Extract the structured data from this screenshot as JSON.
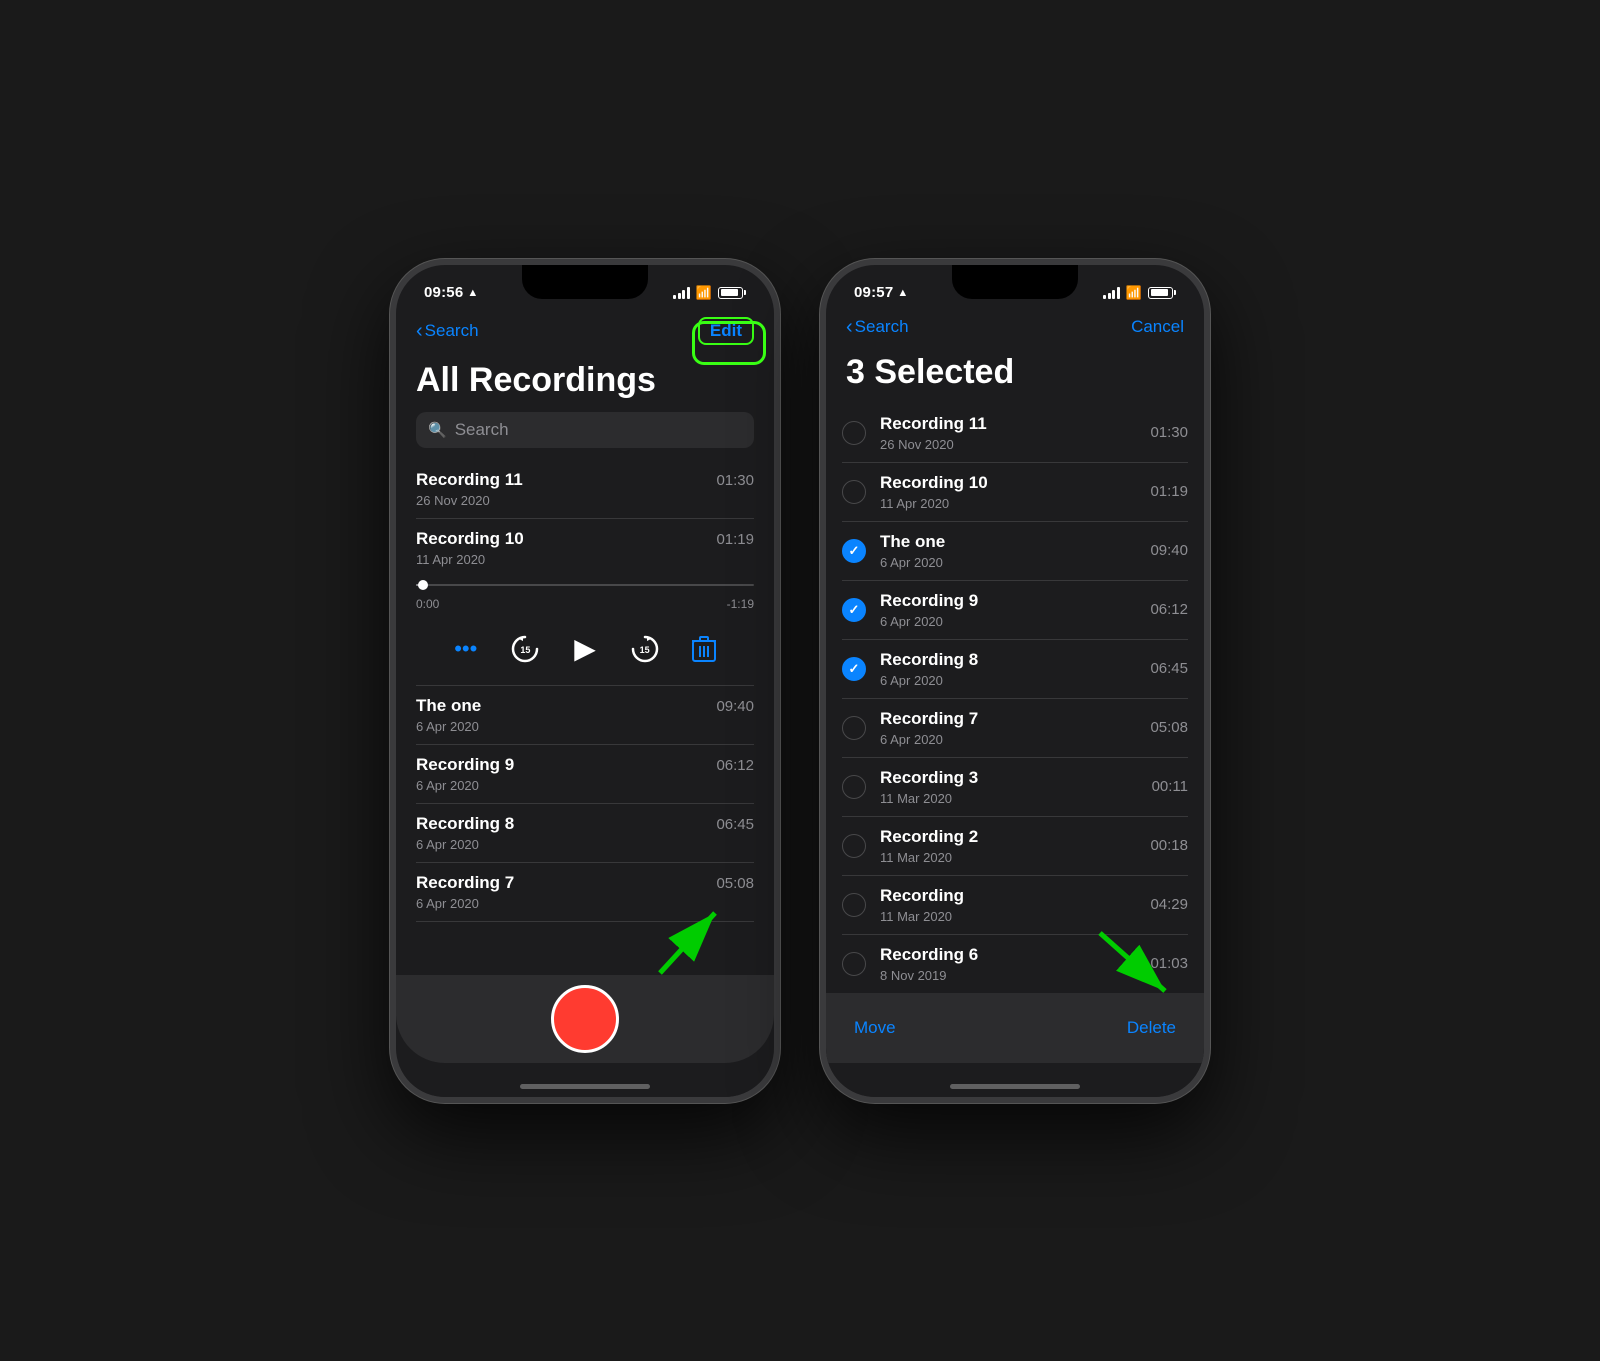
{
  "phone1": {
    "status": {
      "time": "09:56",
      "location_arrow": "▶",
      "signal": [
        4,
        4,
        4,
        4
      ],
      "wifi": true,
      "battery": 85
    },
    "nav": {
      "back_label": "Search",
      "action_label": "Edit"
    },
    "title": "All Recordings",
    "search_placeholder": "Search",
    "recordings": [
      {
        "name": "Recording 11",
        "date": "26 Nov 2020",
        "duration": "01:30",
        "expanded": false
      },
      {
        "name": "Recording 10",
        "date": "11 Apr 2020",
        "duration": "01:19",
        "expanded": true,
        "time_start": "0:00",
        "time_end": "-1:19"
      },
      {
        "name": "The one",
        "date": "6 Apr 2020",
        "duration": "09:40",
        "expanded": false
      },
      {
        "name": "Recording 9",
        "date": "6 Apr 2020",
        "duration": "06:12",
        "expanded": false
      },
      {
        "name": "Recording 8",
        "date": "6 Apr 2020",
        "duration": "06:45",
        "expanded": false
      },
      {
        "name": "Recording 7",
        "date": "6 Apr 2020",
        "duration": "05:08",
        "expanded": false
      }
    ],
    "controls": {
      "more_label": "•••",
      "skip_back_label": "15",
      "skip_fwd_label": "15"
    }
  },
  "phone2": {
    "status": {
      "time": "09:57",
      "signal": [
        4,
        4,
        4,
        4
      ],
      "wifi": true,
      "battery": 85
    },
    "nav": {
      "back_label": "Search",
      "cancel_label": "Cancel"
    },
    "title": "3 Selected",
    "recordings": [
      {
        "name": "Recording 11",
        "date": "26 Nov 2020",
        "duration": "01:30",
        "checked": false
      },
      {
        "name": "Recording 10",
        "date": "11 Apr 2020",
        "duration": "01:19",
        "checked": false
      },
      {
        "name": "The one",
        "date": "6 Apr 2020",
        "duration": "09:40",
        "checked": true
      },
      {
        "name": "Recording 9",
        "date": "6 Apr 2020",
        "duration": "06:12",
        "checked": true
      },
      {
        "name": "Recording 8",
        "date": "6 Apr 2020",
        "duration": "06:45",
        "checked": true
      },
      {
        "name": "Recording 7",
        "date": "6 Apr 2020",
        "duration": "05:08",
        "checked": false
      },
      {
        "name": "Recording 3",
        "date": "11 Mar 2020",
        "duration": "00:11",
        "checked": false
      },
      {
        "name": "Recording 2",
        "date": "11 Mar 2020",
        "duration": "00:18",
        "checked": false
      },
      {
        "name": "Recording",
        "date": "11 Mar 2020",
        "duration": "04:29",
        "checked": false
      },
      {
        "name": "Recording 6",
        "date": "8 Nov 2019",
        "duration": "01:03",
        "checked": false
      }
    ],
    "actions": {
      "move_label": "Move",
      "delete_label": "Delete"
    }
  },
  "annotations": {
    "edit_circle_color": "#39ff14",
    "arrow_color": "#00cc00"
  }
}
